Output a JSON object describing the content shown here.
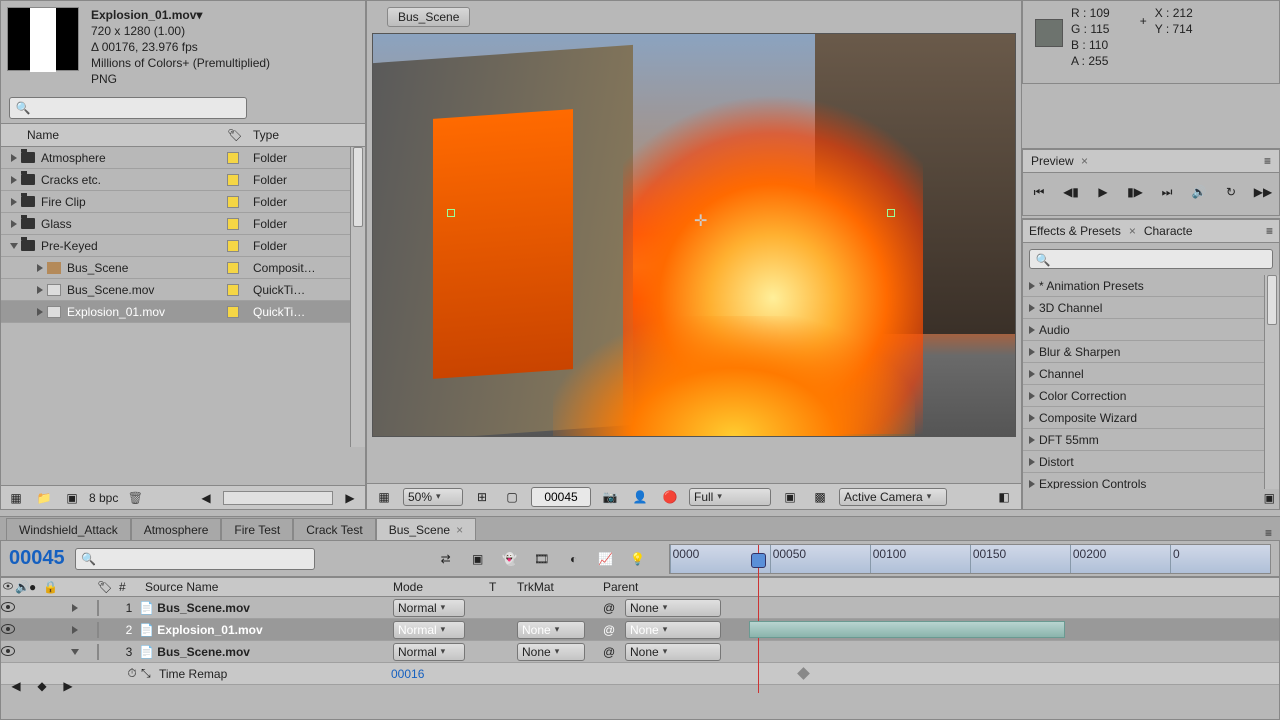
{
  "project": {
    "selected_name": "Explosion_01.mov▾",
    "dimensions": "720 x 1280 (1.00)",
    "duration": "Δ 00176, 23.976 fps",
    "colors": "Millions of Colors+ (Premultiplied)",
    "format": "PNG",
    "search_placeholder": "",
    "columns": {
      "name": "Name",
      "type": "Type"
    },
    "items": [
      {
        "name": "Atmosphere",
        "type": "Folder",
        "kind": "folder"
      },
      {
        "name": "Cracks etc.",
        "type": "Folder",
        "kind": "folder"
      },
      {
        "name": "Fire Clip",
        "type": "Folder",
        "kind": "folder"
      },
      {
        "name": "Glass",
        "type": "Folder",
        "kind": "folder"
      },
      {
        "name": "Pre-Keyed",
        "type": "Folder",
        "kind": "folder-open"
      },
      {
        "name": "Bus_Scene",
        "type": "Composit…",
        "kind": "comp",
        "indent": 1
      },
      {
        "name": "Bus_Scene.mov",
        "type": "QuickTi…",
        "kind": "mov",
        "indent": 1
      },
      {
        "name": "Explosion_01.mov",
        "type": "QuickTi…",
        "kind": "mov",
        "indent": 1,
        "selected": true
      }
    ],
    "bpc": "8 bpc"
  },
  "comp": {
    "name": "Bus_Scene",
    "zoom": "50%",
    "time": "00045",
    "resolution": "Full",
    "view": "Active Camera"
  },
  "info": {
    "r": "R : 109",
    "g": "G : 115",
    "b": "B : 110",
    "a": "A : 255",
    "x": "X : 212",
    "y": "Y : 714"
  },
  "preview": {
    "title": "Preview"
  },
  "effects": {
    "title": "Effects & Presets",
    "tab2": "Characte",
    "items": [
      "* Animation Presets",
      "3D Channel",
      "Audio",
      "Blur & Sharpen",
      "Channel",
      "Color Correction",
      "Composite Wizard",
      "DFT 55mm",
      "Distort",
      "Expression Controls"
    ]
  },
  "timeline": {
    "tabs": [
      "Windshield_Attack",
      "Atmosphere",
      "Fire Test",
      "Crack Test",
      "Bus_Scene"
    ],
    "active_tab": 4,
    "time": "00045",
    "columns": {
      "num": "#",
      "source": "Source Name",
      "mode": "Mode",
      "t": "T",
      "trk": "TrkMat",
      "parent": "Parent"
    },
    "layers": [
      {
        "num": "1",
        "name": "Bus_Scene.mov",
        "mode": "Normal",
        "trk": "",
        "parent": "None",
        "sel": false
      },
      {
        "num": "2",
        "name": "Explosion_01.mov",
        "mode": "Normal",
        "trk": "None",
        "parent": "None",
        "sel": true
      },
      {
        "num": "3",
        "name": "Bus_Scene.mov",
        "mode": "Normal",
        "trk": "None",
        "parent": "None",
        "sel": false
      }
    ],
    "timeremap_label": "Time Remap",
    "timeremap_value": "00016",
    "ruler": [
      "0000",
      "00050",
      "00100",
      "00150",
      "00200",
      "0"
    ]
  }
}
